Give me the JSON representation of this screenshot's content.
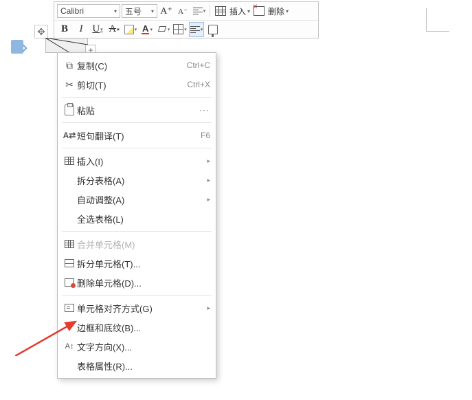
{
  "toolbar": {
    "font_name": "Calibri",
    "font_size": "五号",
    "insert_label": "插入",
    "delete_label": "删除"
  },
  "context_menu": {
    "copy": {
      "label": "复制(C)",
      "accel": "Ctrl+C"
    },
    "cut": {
      "label": "剪切(T)",
      "accel": "Ctrl+X"
    },
    "paste": {
      "label": "粘贴"
    },
    "translate": {
      "label": "短句翻译(T)",
      "accel": "F6"
    },
    "insert": {
      "label": "插入(I)"
    },
    "split_table": {
      "label": "拆分表格(A)"
    },
    "autofit": {
      "label": "自动调整(A)"
    },
    "select_table": {
      "label": "全选表格(L)"
    },
    "merge_cells": {
      "label": "合并单元格(M)"
    },
    "split_cells": {
      "label": "拆分单元格(T)..."
    },
    "delete_cells": {
      "label": "删除单元格(D)..."
    },
    "cell_align": {
      "label": "单元格对齐方式(G)"
    },
    "borders_shading": {
      "label": "边框和底纹(B)..."
    },
    "text_direction": {
      "label": "文字方向(X)..."
    },
    "table_props": {
      "label": "表格属性(R)..."
    }
  }
}
